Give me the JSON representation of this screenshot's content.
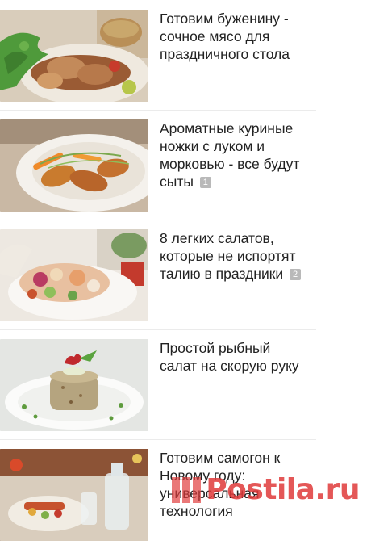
{
  "feed": {
    "items": [
      {
        "title": "Готовим буженину - сочное мясо для праздничного стола",
        "badge": "",
        "thumb_icon": "pork-roast-image"
      },
      {
        "title": "Ароматные куриные ножки с луком и морковью - все будут сыты",
        "badge": "1",
        "thumb_icon": "chicken-legs-image"
      },
      {
        "title": "8 легких салатов, которые не испортят талию в праздники",
        "badge": "2",
        "thumb_icon": "salad-image"
      },
      {
        "title": "Простой рыбный салат на скорую руку",
        "badge": "",
        "thumb_icon": "fish-salad-image"
      },
      {
        "title": "Готовим самогон к Новому году: универсальная технология",
        "badge": "",
        "thumb_icon": "moonshine-image"
      }
    ]
  },
  "watermark": {
    "text": "Postila.ru",
    "color": "#e03a3a"
  }
}
